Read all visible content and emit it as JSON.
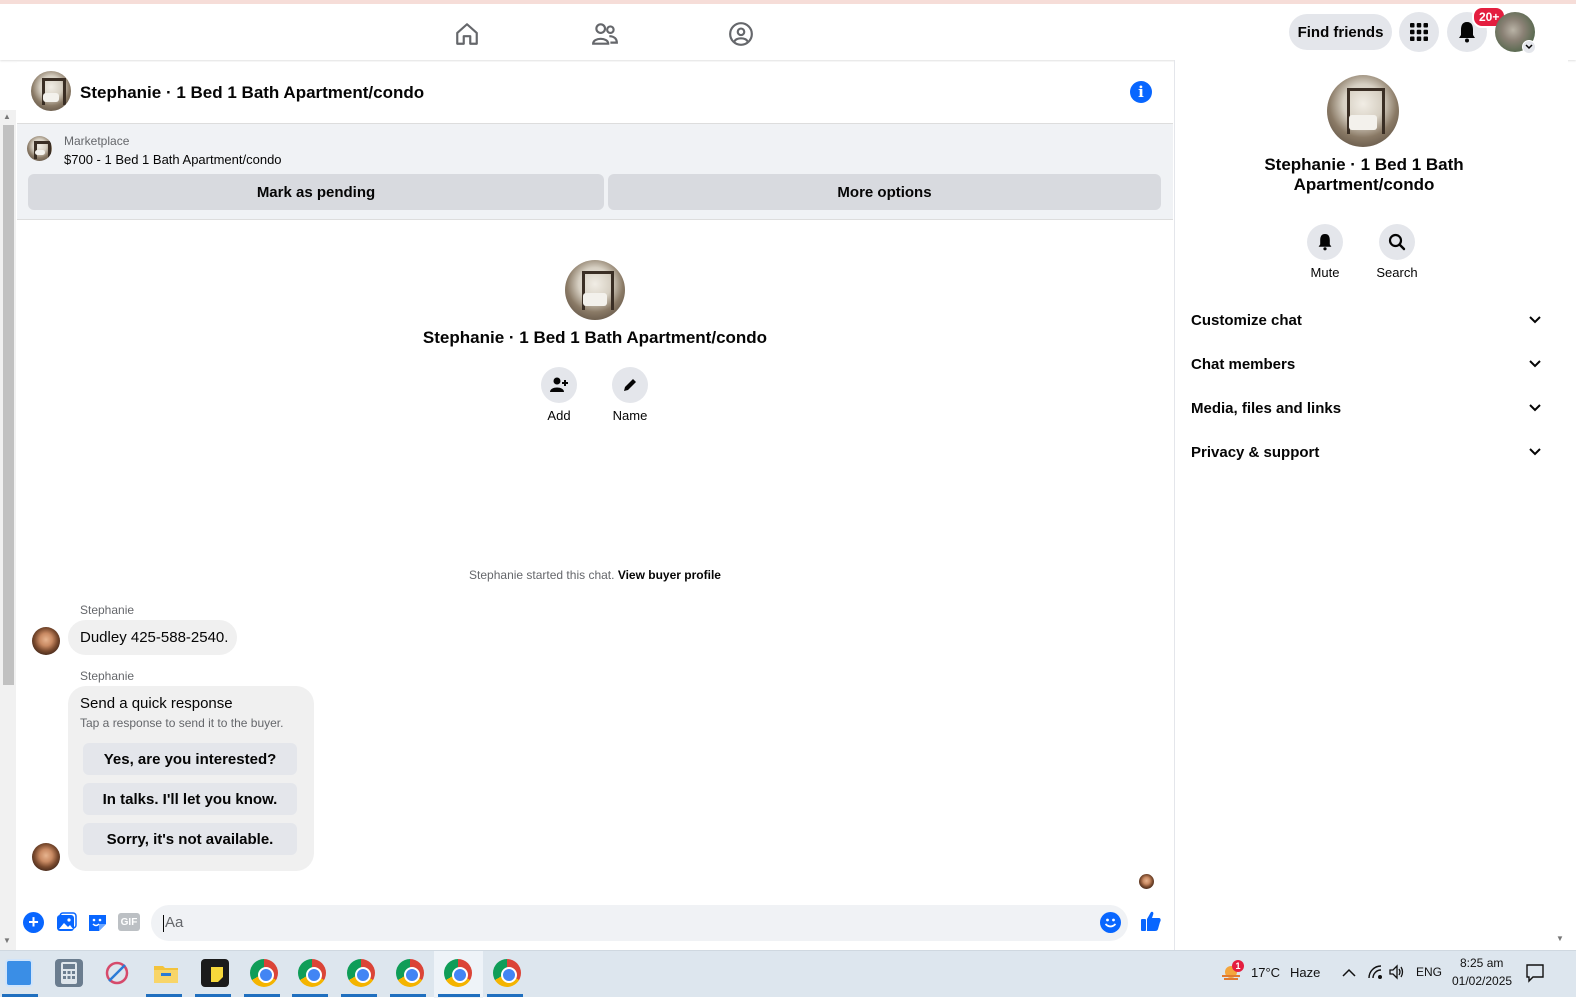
{
  "topbar": {
    "find_friends_label": "Find friends",
    "notifications_badge": "20+"
  },
  "chat": {
    "header_title": "Stephanie · 1 Bed 1 Bath Apartment/condo",
    "marketplace_label": "Marketplace",
    "listing_text": "$700 - 1 Bed 1 Bath Apartment/condo",
    "mark_pending_label": "Mark as pending",
    "more_options_label": "More options",
    "center_title": "Stephanie · 1 Bed 1 Bath Apartment/condo",
    "add_label": "Add",
    "name_label": "Name",
    "started_text": "Stephanie started this chat.",
    "view_buyer_label": "View buyer profile",
    "messages": [
      {
        "sender": "Stephanie",
        "text": "Dudley 425-588-2540."
      },
      {
        "sender": "Stephanie",
        "text": "Send a quick response",
        "subtext": "Tap a response to send it to the buyer."
      }
    ],
    "quick_responses": [
      "Yes, are you interested?",
      "In talks. I'll let you know.",
      "Sorry, it's not available."
    ],
    "composer_placeholder": "Aa"
  },
  "right_panel": {
    "title": "Stephanie · 1 Bed 1 Bath Apartment/condo",
    "mute_label": "Mute",
    "search_label": "Search",
    "sections": [
      "Customize chat",
      "Chat members",
      "Media, files and links",
      "Privacy & support"
    ]
  },
  "taskbar": {
    "weather_temp": "17°C",
    "weather_desc": "Haze",
    "weather_badge": "1",
    "language": "ENG",
    "time": "8:25 am",
    "date": "01/02/2025"
  },
  "colors": {
    "accent": "#0866ff",
    "badge_red": "#e41e3f"
  }
}
